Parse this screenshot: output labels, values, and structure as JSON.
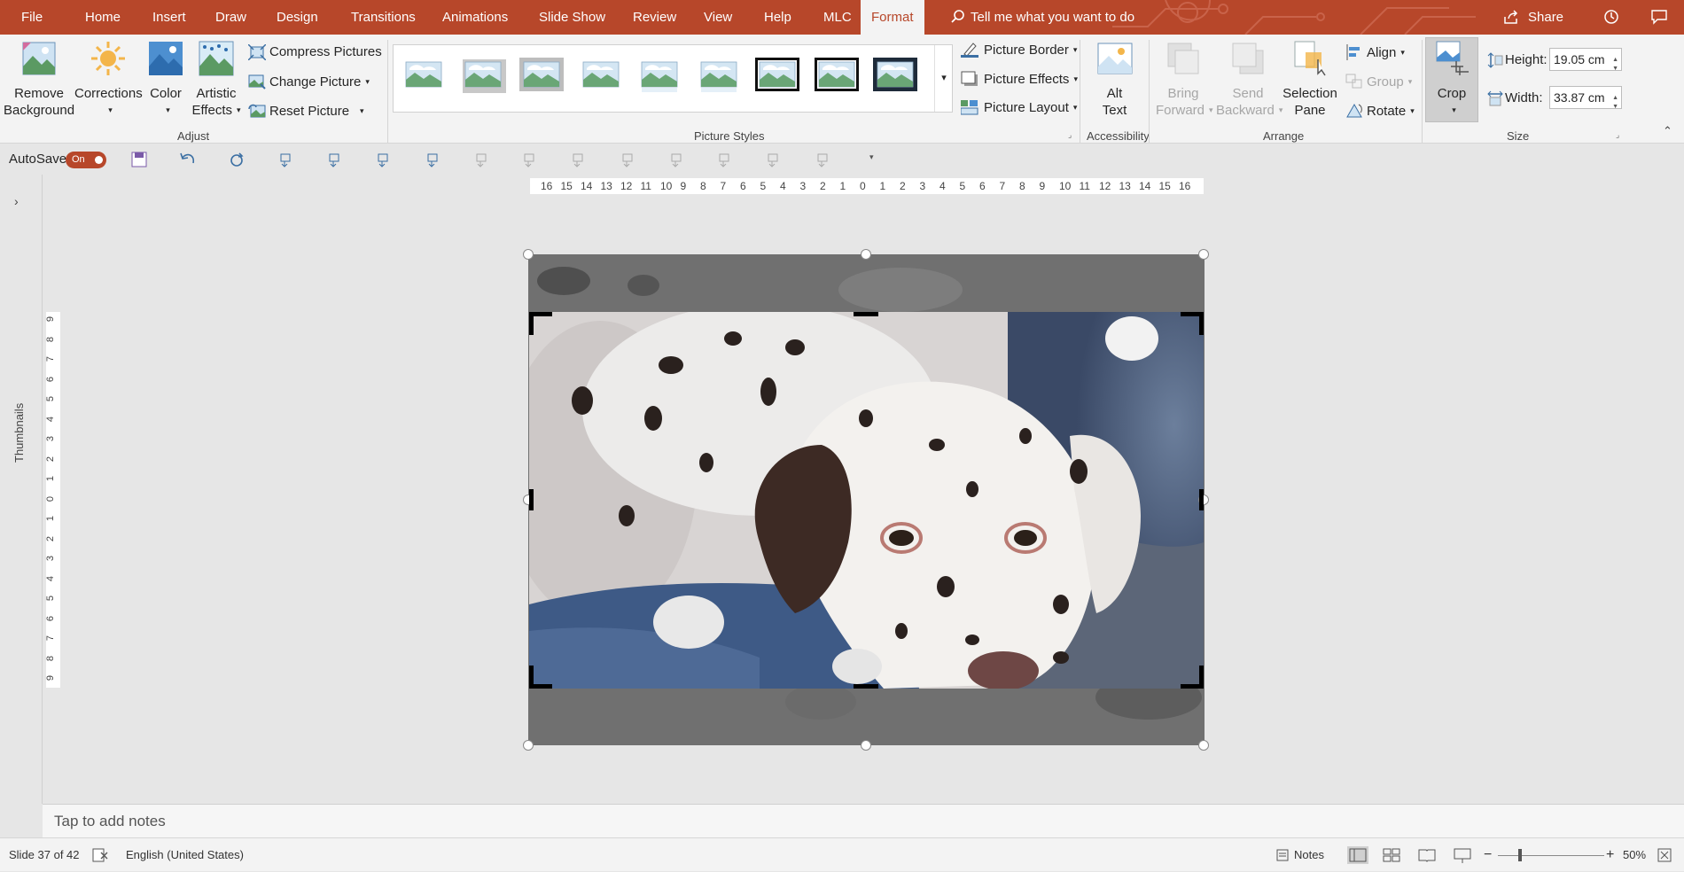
{
  "ribbon_tabs": [
    "File",
    "Home",
    "Insert",
    "Draw",
    "Design",
    "Transitions",
    "Animations",
    "Slide Show",
    "Review",
    "View",
    "Help",
    "MLC",
    "Format"
  ],
  "active_tab": "Format",
  "tell_me": "Tell me what you want to do",
  "share_label": "Share",
  "groups": {
    "adjust": {
      "label": "Adjust",
      "remove_bg_line1": "Remove",
      "remove_bg_line2": "Background",
      "corrections": "Corrections",
      "color": "Color",
      "artistic_line1": "Artistic",
      "artistic_line2": "Effects",
      "compress": "Compress Pictures",
      "change": "Change Picture",
      "reset": "Reset Picture"
    },
    "styles": {
      "label": "Picture Styles",
      "border": "Picture Border",
      "effects": "Picture Effects",
      "layout": "Picture Layout"
    },
    "accessibility": {
      "label": "Accessibility",
      "alt_line1": "Alt",
      "alt_line2": "Text"
    },
    "arrange": {
      "label": "Arrange",
      "bring_line1": "Bring",
      "bring_line2": "Forward",
      "send_line1": "Send",
      "send_line2": "Backward",
      "selection_line1": "Selection",
      "selection_line2": "Pane",
      "align": "Align",
      "group": "Group",
      "rotate": "Rotate"
    },
    "size": {
      "label": "Size",
      "crop": "Crop",
      "height_label": "Height:",
      "height_value": "19.05 cm",
      "width_label": "Width:",
      "width_value": "33.87 cm"
    }
  },
  "qat": {
    "autosave_label": "AutoSave",
    "autosave_state": "On"
  },
  "thumbnails_label": "Thumbnails",
  "hruler_marks": [
    "16",
    "15",
    "14",
    "13",
    "12",
    "11",
    "10",
    "9",
    "8",
    "7",
    "6",
    "5",
    "4",
    "3",
    "2",
    "1",
    "0",
    "1",
    "2",
    "3",
    "4",
    "5",
    "6",
    "7",
    "8",
    "9",
    "10",
    "11",
    "12",
    "13",
    "14",
    "15",
    "16"
  ],
  "vruler_marks": [
    "9",
    "8",
    "7",
    "6",
    "5",
    "4",
    "3",
    "2",
    "1",
    "0",
    "1",
    "2",
    "3",
    "4",
    "5",
    "6",
    "7",
    "8",
    "9"
  ],
  "notes_placeholder": "Tap to add notes",
  "status": {
    "slide": "Slide 37 of 42",
    "language": "English (United States)",
    "notes": "Notes",
    "zoom": "50%"
  },
  "colors": {
    "accent": "#b7472a",
    "ribbon_bg": "#f3f3f3",
    "canvas_bg": "#e6e6e6"
  }
}
